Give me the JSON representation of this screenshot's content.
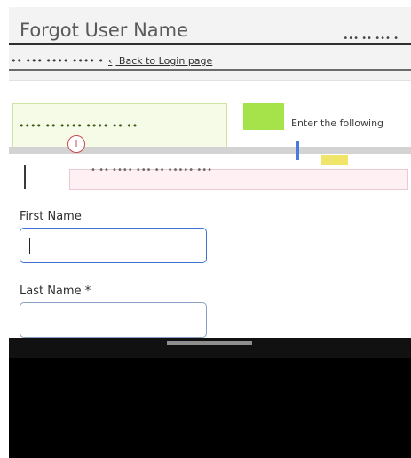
{
  "header": {
    "title": "Forgot User Name",
    "right_text": "••• •• ••• •",
    "breadcrumb_left": "•• ••• •••• •••• •",
    "back_label": "Back to Login page"
  },
  "notice": {
    "main_text": "•••• •• •••• •••• •• ••",
    "right_text": "Enter the following",
    "info_icon": "info-icon",
    "hint": "• •• •••• ••• •• ••••• •••"
  },
  "form": {
    "first_name": {
      "label": "First Name",
      "value": ""
    },
    "last_name": {
      "label": "Last Name *",
      "value": ""
    }
  },
  "colors": {
    "accent_blue": "#3f6fd0",
    "notice_green": "#a6e34a",
    "dark": "#111111"
  }
}
